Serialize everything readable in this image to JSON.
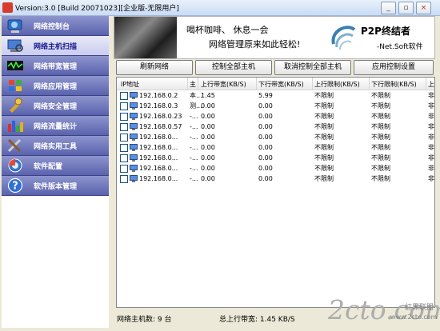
{
  "window": {
    "title": "Version:3.0 [Build 20071023][企业版-无限用户]"
  },
  "titlebar": {
    "minimize": "_",
    "restore": "▫",
    "close": "×"
  },
  "sidebar": {
    "items": [
      {
        "label": "网络控制台",
        "icon": "console-icon",
        "active": false
      },
      {
        "label": "网络主机扫描",
        "icon": "host-scan-icon",
        "active": true
      },
      {
        "label": "网络带宽管理",
        "icon": "bandwidth-icon",
        "active": false
      },
      {
        "label": "网络应用管理",
        "icon": "app-manage-icon",
        "active": false
      },
      {
        "label": "网络安全管理",
        "icon": "security-icon",
        "active": false
      },
      {
        "label": "网络流量统计",
        "icon": "traffic-stats-icon",
        "active": false
      },
      {
        "label": "网络实用工具",
        "icon": "tools-icon",
        "active": false
      },
      {
        "label": "软件配置",
        "icon": "settings-icon",
        "active": false
      },
      {
        "label": "软件版本管理",
        "icon": "help-icon",
        "active": false
      }
    ]
  },
  "banner": {
    "line1": "喝杯咖啡、 休息一会",
    "line2": "网络管理原来如此轻松!",
    "brand": "P2P终结者",
    "sub": "-Net.Soft软件"
  },
  "toolbar": {
    "refresh": "刷新网络",
    "control_all": "控制全部主机",
    "cancel_all": "取消控制全部主机",
    "apply": "应用控制设置"
  },
  "table": {
    "headers": [
      "IP地址",
      "主",
      "上行带宽(KB/S)",
      "下行带宽(KB/S)",
      "上行限制(KB/S)",
      "下行限制(KB/S)",
      "上"
    ],
    "rows": [
      {
        "ip": "192.168.0.2",
        "host": "本...",
        "up": "1.45",
        "down": "5.99",
        "up_limit": "不限制",
        "down_limit": "不限制",
        "extra": "非"
      },
      {
        "ip": "192.168.0.3",
        "host": "测...",
        "up": "0.00",
        "down": "0.00",
        "up_limit": "不限制",
        "down_limit": "不限制",
        "extra": "非"
      },
      {
        "ip": "192.168.0.23",
        "host": "-...",
        "up": "0.00",
        "down": "0.00",
        "up_limit": "不限制",
        "down_limit": "不限制",
        "extra": "非"
      },
      {
        "ip": "192.168.0.57",
        "host": "-...",
        "up": "0.00",
        "down": "0.00",
        "up_limit": "不限制",
        "down_limit": "不限制",
        "extra": "非"
      },
      {
        "ip": "192.168.0...",
        "host": "-...",
        "up": "0.00",
        "down": "0.00",
        "up_limit": "不限制",
        "down_limit": "不限制",
        "extra": "非"
      },
      {
        "ip": "192.168.0...",
        "host": "-...",
        "up": "0.00",
        "down": "0.00",
        "up_limit": "不限制",
        "down_limit": "不限制",
        "extra": "非"
      },
      {
        "ip": "192.168.0...",
        "host": "-...",
        "up": "0.00",
        "down": "0.00",
        "up_limit": "不限制",
        "down_limit": "不限制",
        "extra": "非"
      },
      {
        "ip": "192.168.0...",
        "host": "-...",
        "up": "0.00",
        "down": "0.00",
        "up_limit": "不限制",
        "down_limit": "不限制",
        "extra": "非"
      },
      {
        "ip": "192.168.0...",
        "host": "-...",
        "up": "0.00",
        "down": "0.00",
        "up_limit": "不限制",
        "down_limit": "不限制",
        "extra": "非"
      }
    ]
  },
  "status": {
    "host_count": "网络主机数: 9 台",
    "total_up": "总上行带宽: 1.45 KB/S"
  },
  "watermark": {
    "main": "2cto.com",
    "side": "红黑联盟",
    "url": "www.2cto.com"
  }
}
